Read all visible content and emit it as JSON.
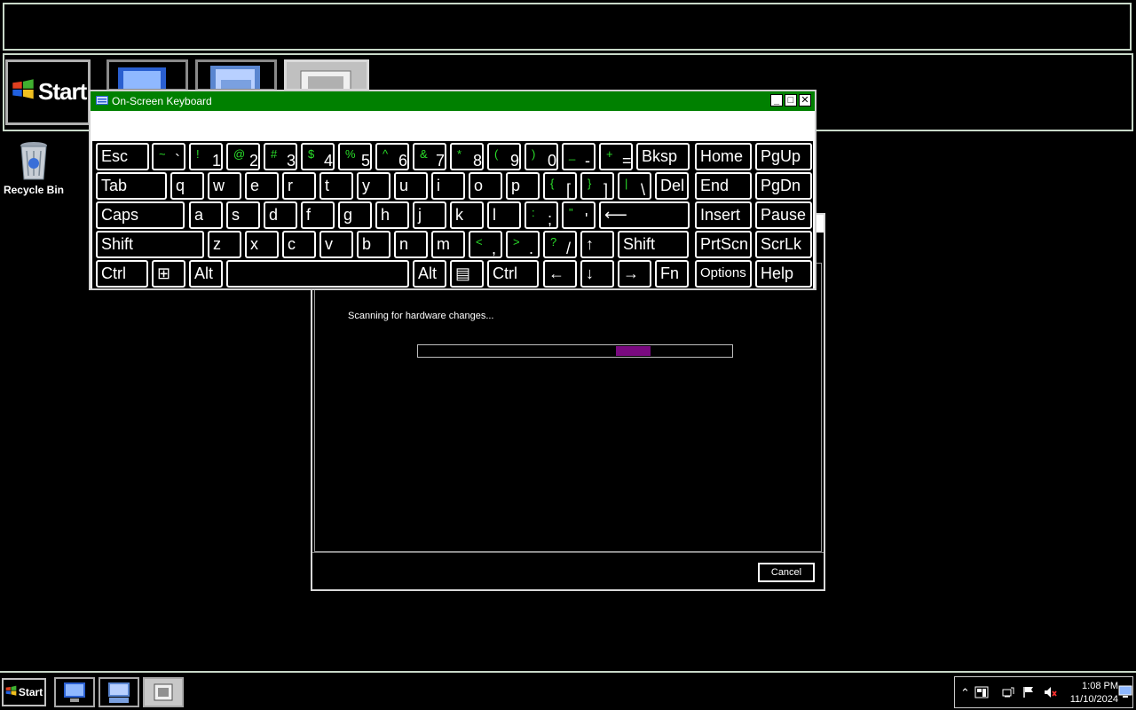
{
  "magnifier": {
    "start_label": "Start"
  },
  "desktop": {
    "recycle_bin_label": "Recycle Bin"
  },
  "dialog": {
    "status_text": "Scanning for hardware changes...",
    "progress_fraction_start": 0.63,
    "progress_fraction_end": 0.74,
    "progress_color": "#7a0a80",
    "cancel_label": "Cancel"
  },
  "osk": {
    "title": "On-Screen Keyboard",
    "title_color": "#008000",
    "shift_legend_color": "#2adf2a",
    "rows": [
      [
        {
          "name": "esc",
          "main": "Esc"
        },
        {
          "name": "backtick",
          "shift": "~",
          "low": "`"
        },
        {
          "name": "1",
          "shift": "!",
          "low": "1"
        },
        {
          "name": "2",
          "shift": "@",
          "low": "2"
        },
        {
          "name": "3",
          "shift": "#",
          "low": "3"
        },
        {
          "name": "4",
          "shift": "$",
          "low": "4"
        },
        {
          "name": "5",
          "shift": "%",
          "low": "5"
        },
        {
          "name": "6",
          "shift": "^",
          "low": "6"
        },
        {
          "name": "7",
          "shift": "&",
          "low": "7"
        },
        {
          "name": "8",
          "shift": "*",
          "low": "8"
        },
        {
          "name": "9",
          "shift": "(",
          "low": "9"
        },
        {
          "name": "0",
          "shift": ")",
          "low": "0"
        },
        {
          "name": "minus",
          "shift": "_",
          "low": "-"
        },
        {
          "name": "equals",
          "shift": "+",
          "low": "="
        },
        {
          "name": "bksp",
          "main": "Bksp"
        },
        {
          "name": "home",
          "main": "Home"
        },
        {
          "name": "pgup",
          "main": "PgUp"
        }
      ],
      [
        {
          "name": "tab",
          "main": "Tab"
        },
        {
          "name": "q",
          "main": "q"
        },
        {
          "name": "w",
          "main": "w"
        },
        {
          "name": "e",
          "main": "e"
        },
        {
          "name": "r",
          "main": "r"
        },
        {
          "name": "t",
          "main": "t"
        },
        {
          "name": "y",
          "main": "y"
        },
        {
          "name": "u",
          "main": "u"
        },
        {
          "name": "i",
          "main": "i"
        },
        {
          "name": "o",
          "main": "o"
        },
        {
          "name": "p",
          "main": "p"
        },
        {
          "name": "lbracket",
          "shift": "{",
          "low": "["
        },
        {
          "name": "rbracket",
          "shift": "}",
          "low": "]"
        },
        {
          "name": "backslash",
          "shift": "|",
          "low": "\\"
        },
        {
          "name": "del",
          "main": "Del"
        },
        {
          "name": "end",
          "main": "End"
        },
        {
          "name": "pgdn",
          "main": "PgDn"
        }
      ],
      [
        {
          "name": "caps",
          "main": "Caps"
        },
        {
          "name": "a",
          "main": "a"
        },
        {
          "name": "s",
          "main": "s"
        },
        {
          "name": "d",
          "main": "d"
        },
        {
          "name": "f",
          "main": "f"
        },
        {
          "name": "g",
          "main": "g"
        },
        {
          "name": "h",
          "main": "h"
        },
        {
          "name": "j",
          "main": "j"
        },
        {
          "name": "k",
          "main": "k"
        },
        {
          "name": "l",
          "main": "l"
        },
        {
          "name": "semicolon",
          "shift": ":",
          "low": ";"
        },
        {
          "name": "quote",
          "shift": "\"",
          "low": "'"
        },
        {
          "name": "enter",
          "main": "⟵"
        },
        {
          "name": "insert",
          "main": "Insert"
        },
        {
          "name": "pause",
          "main": "Pause"
        }
      ],
      [
        {
          "name": "lshift",
          "main": "Shift"
        },
        {
          "name": "z",
          "main": "z"
        },
        {
          "name": "x",
          "main": "x"
        },
        {
          "name": "c",
          "main": "c"
        },
        {
          "name": "v",
          "main": "v"
        },
        {
          "name": "b",
          "main": "b"
        },
        {
          "name": "n",
          "main": "n"
        },
        {
          "name": "m",
          "main": "m"
        },
        {
          "name": "comma",
          "shift": "<",
          "low": ","
        },
        {
          "name": "period",
          "shift": ">",
          "low": "."
        },
        {
          "name": "slash",
          "shift": "?",
          "low": "/"
        },
        {
          "name": "up",
          "main": "↑"
        },
        {
          "name": "rshift",
          "main": "Shift"
        },
        {
          "name": "prtscn",
          "main": "PrtScn"
        },
        {
          "name": "scrlk",
          "main": "ScrLk"
        }
      ],
      [
        {
          "name": "lctrl",
          "main": "Ctrl"
        },
        {
          "name": "win",
          "main": "⊞"
        },
        {
          "name": "lalt",
          "main": "Alt"
        },
        {
          "name": "space",
          "main": ""
        },
        {
          "name": "ralt",
          "main": "Alt"
        },
        {
          "name": "menu",
          "main": "▤"
        },
        {
          "name": "rctrl",
          "main": "Ctrl"
        },
        {
          "name": "left",
          "main": "←"
        },
        {
          "name": "down",
          "main": "↓"
        },
        {
          "name": "right",
          "main": "→"
        },
        {
          "name": "fn",
          "main": "Fn"
        },
        {
          "name": "options",
          "main": "Options"
        },
        {
          "name": "help",
          "main": "Help"
        }
      ]
    ]
  },
  "taskbar": {
    "start_label": "Start",
    "clock_time": "1:08 PM",
    "clock_date": "11/10/2024"
  }
}
